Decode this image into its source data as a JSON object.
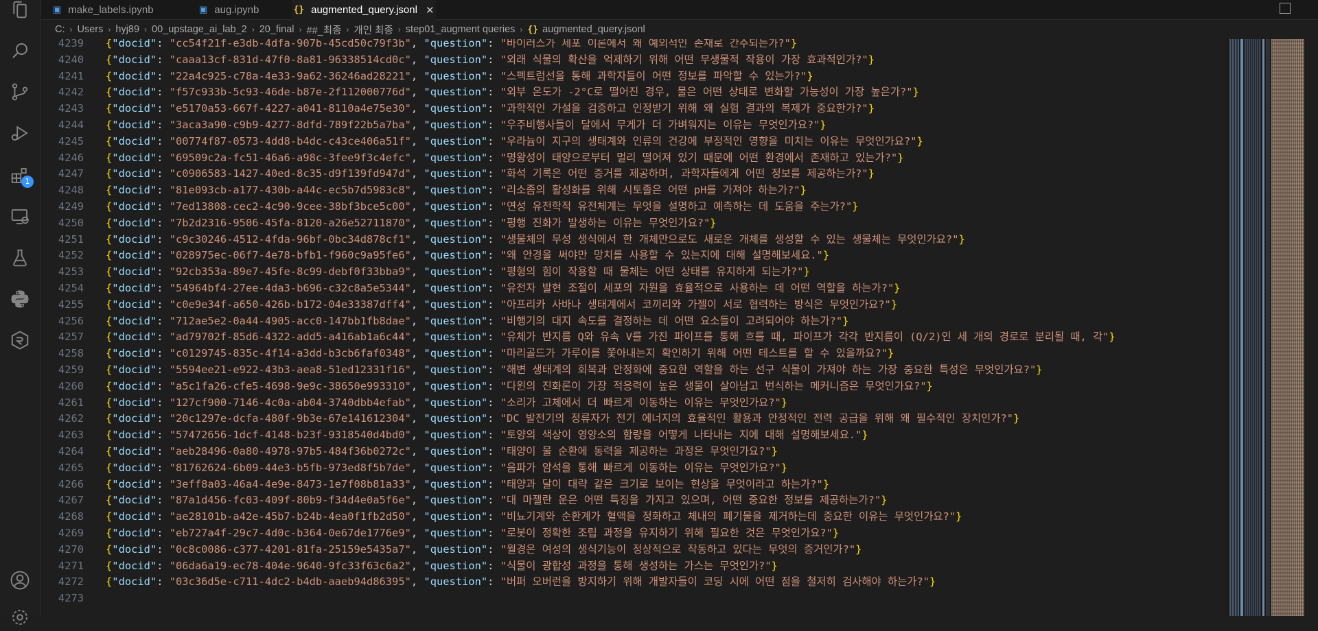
{
  "tabs": [
    {
      "label": "make_labels.ipynb",
      "type": "notebook",
      "active": false
    },
    {
      "label": "aug.ipynb",
      "type": "notebook",
      "active": false
    },
    {
      "label": "augmented_query.jsonl",
      "type": "json",
      "active": true
    }
  ],
  "json_icon_glyph": "{}",
  "close_glyph": "✕",
  "breadcrumb": [
    "C:",
    "Users",
    "hyj89",
    "00_upstage_ai_lab_2",
    "20_final",
    "##_최종",
    "개인 최종",
    "step01_augment queries",
    "augmented_query.jsonl"
  ],
  "extensions_badge": "1",
  "icons": [
    "explorer-icon",
    "search-icon",
    "source-control-icon",
    "run-debug-icon",
    "extensions-icon",
    "remote-explorer-icon",
    "testing-icon",
    "python-icon",
    "ruff-icon",
    "account-icon"
  ],
  "colors": {
    "background": "#1e1e1e",
    "brace": "#ffd700",
    "key": "#9cdcfe",
    "string": "#ce9178",
    "line_number": "#6e7681",
    "badge": "#3794ff"
  },
  "json_keys": {
    "docid": "docid",
    "question": "question"
  },
  "lines": [
    {
      "n": "4239",
      "docid": "cc54f21f-e3db-4dfa-907b-45cd50c79f3b",
      "question": "바이러스가 세포 이론에서 왜 예외적인 존재로 간주되는가?"
    },
    {
      "n": "4240",
      "docid": "caaa13cf-831d-47f0-8a81-96338514cd0c",
      "question": "외래 식물의 확산을 억제하기 위해 어떤 무생물적 작용이 가장 효과적인가?"
    },
    {
      "n": "4241",
      "docid": "22a4c925-c78a-4e33-9a62-36246ad28221",
      "question": "스펙트럼선을 통해 과학자들이 어떤 정보를 파악할 수 있는가?"
    },
    {
      "n": "4242",
      "docid": "f57c933b-5c93-46de-b87e-2f112000776d",
      "question": "외부 온도가 -2°C로 떨어진 경우, 물은 어떤 상태로 변화할 가능성이 가장 높은가?"
    },
    {
      "n": "4243",
      "docid": "e5170a53-667f-4227-a041-8110a4e75e30",
      "question": "과학적인 가설을 검증하고 인정받기 위해 왜 실험 결과의 복제가 중요한가?"
    },
    {
      "n": "4244",
      "docid": "3aca3a90-c9b9-4277-8dfd-789f22b5a7ba",
      "question": "우주비행사들이 달에서 무게가 더 가벼워지는 이유는 무엇인가요?"
    },
    {
      "n": "4245",
      "docid": "00774f87-0573-4dd8-b4dc-c43ce406a51f",
      "question": "우라늄이 지구의 생태계와 인류의 건강에 부정적인 영향을 미치는 이유는 무엇인가요?"
    },
    {
      "n": "4246",
      "docid": "69509c2a-fc51-46a6-a98c-3fee9f3c4efc",
      "question": "명왕성이 태양으로부터 멀리 떨어져 있기 때문에 어떤 환경에서 존재하고 있는가?"
    },
    {
      "n": "4247",
      "docid": "c0906583-1427-40ed-8c35-d9f139fd947d",
      "question": "화석 기록은 어떤 증거를 제공하며, 과학자들에게 어떤 정보를 제공하는가?"
    },
    {
      "n": "4248",
      "docid": "81e093cb-a177-430b-a44c-ec5b7d5983c8",
      "question": "리소좀의 활성화를 위해 시토졸은 어떤 pH를 가져야 하는가?"
    },
    {
      "n": "4249",
      "docid": "7ed13808-cec2-4c90-9cee-38bf3bce5c00",
      "question": "연성 유전학적 유전체계는 무엇을 설명하고 예측하는 데 도움을 주는가?"
    },
    {
      "n": "4250",
      "docid": "7b2d2316-9506-45fa-8120-a26e52711870",
      "question": "평행 진화가 발생하는 이유는 무엇인가요?"
    },
    {
      "n": "4251",
      "docid": "c9c30246-4512-4fda-96bf-0bc34d878cf1",
      "question": "생물체의 무성 생식에서 한 개체만으로도 새로운 개체를 생성할 수 있는 생물체는 무엇인가요?"
    },
    {
      "n": "4252",
      "docid": "028975ec-06f7-4e78-bfb1-f960c9a95fe6",
      "question": "왜 안경을 써야만 망치를 사용할 수 있는지에 대해 설명해보세요."
    },
    {
      "n": "4253",
      "docid": "92cb353a-89e7-45fe-8c99-debf0f33bba9",
      "question": "평형의 힘이 작용할 때 물체는 어떤 상태를 유지하게 되는가?"
    },
    {
      "n": "4254",
      "docid": "54964bf4-27ee-4da3-b696-c32c8a5e5344",
      "question": "유전자 발현 조절이 세포의 자원을 효율적으로 사용하는 데 어떤 역할을 하는가?"
    },
    {
      "n": "4255",
      "docid": "c0e9e34f-a650-426b-b172-04e33387dff4",
      "question": "아프리카 사바나 생태계에서 코끼리와 가젤이 서로 협력하는 방식은 무엇인가요?"
    },
    {
      "n": "4256",
      "docid": "712ae5e2-0a44-4905-acc0-147bb1fb8dae",
      "question": "비행기의 대지 속도를 결정하는 데 어떤 요소들이 고려되어야 하는가?"
    },
    {
      "n": "4257",
      "docid": "ad79702f-85d6-4322-add5-a416ab1a6c44",
      "question": "유체가 반지름 Q와 유속 V를 가진 파이프를 통해 흐를 때, 파이프가 각각 반지름이 (Q/2)인 세 개의 경로로 분리될 때, 각"
    },
    {
      "n": "4258",
      "docid": "c0129745-835c-4f14-a3dd-b3cb6faf0348",
      "question": "마리골드가 가루이를 쫓아내는지 확인하기 위해 어떤 테스트를 할 수 있을까요?"
    },
    {
      "n": "4259",
      "docid": "5594ee21-e922-43b3-aea8-51ed12331f16",
      "question": "해변 생태계의 회복과 안정화에 중요한 역할을 하는 선구 식물이 가져야 하는 가장 중요한 특성은 무엇인가요?"
    },
    {
      "n": "4260",
      "docid": "a5c1fa26-cfe5-4698-9e9c-38650e993310",
      "question": "다윈의 진화론이 가장 적응력이 높은 생물이 살아남고 번식하는 메커니즘은 무엇인가요?"
    },
    {
      "n": "4261",
      "docid": "127cf900-7146-4c0a-ab04-3740dbb4efab",
      "question": "소리가 고체에서 더 빠르게 이동하는 이유는 무엇인가요?"
    },
    {
      "n": "4262",
      "docid": "20c1297e-dcfa-480f-9b3e-67e141612304",
      "question": "DC 발전기의 정류자가 전기 에너지의 효율적인 활용과 안정적인 전력 공급을 위해 왜 필수적인 장치인가?"
    },
    {
      "n": "4263",
      "docid": "57472656-1dcf-4148-b23f-9318540d4bd0",
      "question": "토양의 색상이 영양소의 함량을 어떻게 나타내는 지에 대해 설명해보세요."
    },
    {
      "n": "4264",
      "docid": "aeb28496-0a80-4978-97b5-484f36b0272c",
      "question": "태양이 물 순환에 동력을 제공하는 과정은 무엇인가요?"
    },
    {
      "n": "4265",
      "docid": "81762624-6b09-44e3-b5fb-973ed8f5b7de",
      "question": "음파가 암석을 통해 빠르게 이동하는 이유는 무엇인가요?"
    },
    {
      "n": "4266",
      "docid": "3eff8a03-46a4-4e9e-8473-1e7f08b81a33",
      "question": "태양과 달이 대략 같은 크기로 보이는 현상을 무엇이라고 하는가?"
    },
    {
      "n": "4267",
      "docid": "87a1d456-fc03-409f-80b9-f34d4e0a5f6e",
      "question": "대 마젤란 운은 어떤 특징을 가지고 있으며, 어떤 중요한 정보를 제공하는가?"
    },
    {
      "n": "4268",
      "docid": "ae28101b-a42e-45b7-b24b-4ea0f1fb2d50",
      "question": "비뇨기계와 순환계가 혈액을 정화하고 체내의 폐기물을 제거하는데 중요한 이유는 무엇인가요?"
    },
    {
      "n": "4269",
      "docid": "eb727a4f-29c7-4d0c-b364-0e67de1776e9",
      "question": "로봇이 정확한 조립 과정을 유지하기 위해 필요한 것은 무엇인가요?"
    },
    {
      "n": "4270",
      "docid": "0c8c0086-c377-4201-81fa-25159e5435a7",
      "question": "월경은 여성의 생식기능이 정상적으로 작동하고 있다는 무엇의 증거인가?"
    },
    {
      "n": "4271",
      "docid": "06da6a19-ec78-404e-9640-9fc33f63c6a2",
      "question": "식물이 광합성 과정을 통해 생성하는 가스는 무엇인가?"
    },
    {
      "n": "4272",
      "docid": "03c36d5e-c711-4dc2-b4db-aaeb94d86395",
      "question": "버퍼 오버런을 방지하기 위해 개발자들이 코딩 시에 어떤 점을 철저히 검사해야 하는가?"
    },
    {
      "n": "4273",
      "docid": "",
      "question": ""
    }
  ]
}
